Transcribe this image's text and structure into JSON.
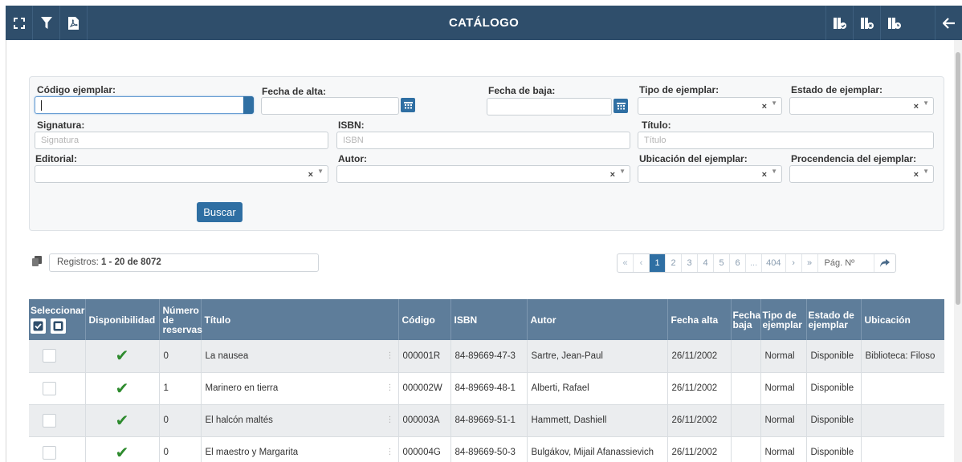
{
  "header": {
    "title": "CATÁLOGO",
    "left_icons": [
      "fullscreen-icon",
      "filter-icon",
      "pdf-icon"
    ],
    "right_icons": [
      "book-check-icon",
      "book-cancel-icon",
      "book-clock-icon",
      "back-arrow-icon"
    ]
  },
  "filters": {
    "codigo_ejemplar": {
      "label": "Código ejemplar:",
      "value": ""
    },
    "fecha_alta": {
      "label": "Fecha de alta:",
      "value": ""
    },
    "fecha_baja": {
      "label": "Fecha de baja:",
      "value": ""
    },
    "tipo_ejemplar": {
      "label": "Tipo de ejemplar:",
      "value": ""
    },
    "estado_ejemplar": {
      "label": "Estado de ejemplar:",
      "value": ""
    },
    "signatura": {
      "label": "Signatura:",
      "placeholder": "Signatura"
    },
    "isbn": {
      "label": "ISBN:",
      "placeholder": "ISBN"
    },
    "titulo": {
      "label": "Título:",
      "placeholder": "Título"
    },
    "editorial": {
      "label": "Editorial:",
      "value": ""
    },
    "autor": {
      "label": "Autor:",
      "value": ""
    },
    "ubicacion": {
      "label": "Ubicación del ejemplar:",
      "value": ""
    },
    "procedencia": {
      "label": "Procendencia del ejemplar:",
      "value": ""
    },
    "clear_symbol": "×",
    "arrow_symbol": "▼",
    "search_button": "Buscar"
  },
  "results": {
    "registros_prefix": "Registros: ",
    "registros_range": "1 - 20 de 8072",
    "pager": {
      "first": "«",
      "prev": "‹",
      "pages": [
        "1",
        "2",
        "3",
        "4",
        "5",
        "6"
      ],
      "ellipsis": "...",
      "last_page": "404",
      "next": "›",
      "last": "»",
      "page_no_placeholder": "Pág. Nº",
      "current_page": 1
    }
  },
  "table": {
    "columns": {
      "seleccionar": "Seleccionar",
      "disponibilidad": "Disponibilidad",
      "num_reservas_1": "Número",
      "num_reservas_2": "de",
      "num_reservas_3": "reservas",
      "titulo": "Título",
      "codigo": "Código",
      "isbn": "ISBN",
      "autor": "Autor",
      "fecha_alta": "Fecha alta",
      "fecha_baja_1": "Fecha",
      "fecha_baja_2": "baja",
      "tipo_1": "Tipo de",
      "tipo_2": "ejemplar",
      "estado_1": "Estado de",
      "estado_2": "ejemplar",
      "ubicacion": "Ubicación"
    },
    "rows": [
      {
        "reservas": "0",
        "titulo": "La nausea",
        "codigo": "000001R",
        "isbn": "84-89669-47-3",
        "autor": "Sartre, Jean-Paul",
        "fecha_alta": "26/11/2002",
        "fecha_baja": "",
        "tipo": "Normal",
        "estado": "Disponible",
        "ubicacion": "Biblioteca: Filoso"
      },
      {
        "reservas": "1",
        "titulo": "Marinero en tierra",
        "codigo": "000002W",
        "isbn": "84-89669-48-1",
        "autor": "Alberti, Rafael",
        "fecha_alta": "26/11/2002",
        "fecha_baja": "",
        "tipo": "Normal",
        "estado": "Disponible",
        "ubicacion": ""
      },
      {
        "reservas": "0",
        "titulo": "El halcón maltés",
        "codigo": "000003A",
        "isbn": "84-89669-51-1",
        "autor": "Hammett, Dashiell",
        "fecha_alta": "26/11/2002",
        "fecha_baja": "",
        "tipo": "Normal",
        "estado": "Disponible",
        "ubicacion": ""
      },
      {
        "reservas": "0",
        "titulo": "El maestro y Margarita",
        "codigo": "000004G",
        "isbn": "84-89669-50-3",
        "autor": "Bulgákov, Mijail Afanassievich",
        "fecha_alta": "26/11/2002",
        "fecha_baja": "",
        "tipo": "Normal",
        "estado": "Disponible",
        "ubicacion": ""
      }
    ],
    "tick": "✔",
    "row_menu": "⋮"
  },
  "colors": {
    "header_bg": "#2f4e6b",
    "accent": "#2f6fa3",
    "table_header_bg": "#5e7d9a",
    "available_green": "#2e8b2e"
  }
}
